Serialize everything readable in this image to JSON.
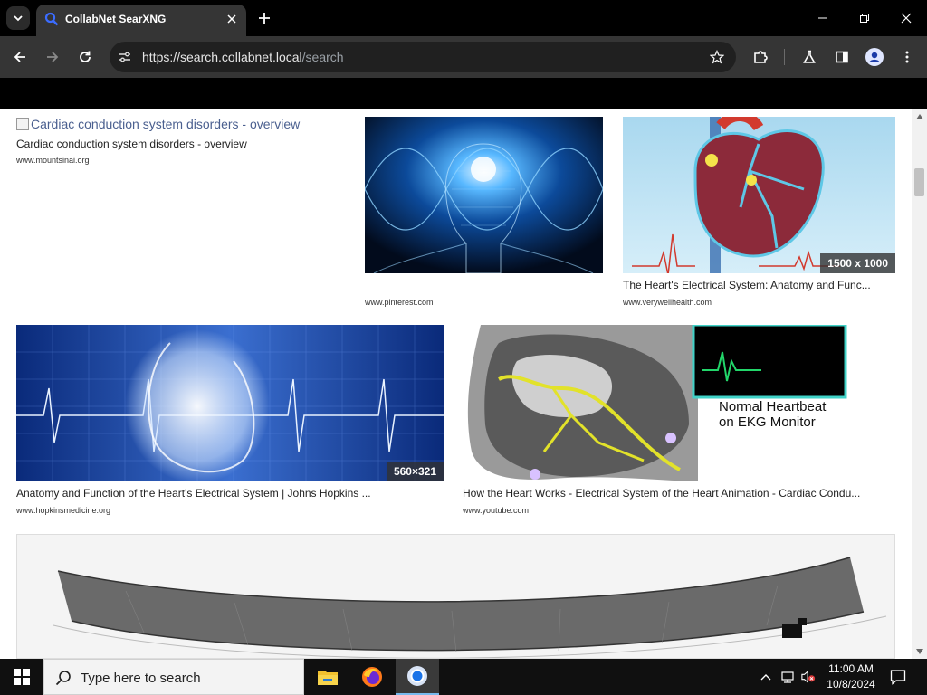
{
  "browser": {
    "tab": {
      "title": "CollabNet SearXNG",
      "close_icon": "close-icon",
      "favicon": "search-icon"
    },
    "url": {
      "host": "https://search.collabnet.local",
      "path": "/search"
    },
    "colors": {
      "titlebar": "#000000",
      "toolbar": "#353535",
      "omnibox": "#202020"
    }
  },
  "results": [
    {
      "broken_alt": "Cardiac conduction system disorders - overview",
      "title": "Cardiac conduction system disorders - overview",
      "site": "www.mountsinai.org"
    },
    {
      "title": "",
      "site": "www.pinterest.com"
    },
    {
      "title": "The Heart's Electrical System: Anatomy and Func...",
      "site": "www.verywellhealth.com",
      "resolution": "1500 x 1000"
    },
    {
      "title": "Anatomy and Function of the Heart's Electrical System | Johns Hopkins ...",
      "site": "www.hopkinsmedicine.org",
      "resolution": "560×321"
    },
    {
      "title": "How the Heart Works - Electrical System of the Heart Animation - Cardiac Condu...",
      "site": "www.youtube.com",
      "image_caption_1": "Normal Heartbeat",
      "image_caption_2": "on EKG Monitor"
    },
    {
      "title": "",
      "site": ""
    }
  ],
  "taskbar": {
    "search_placeholder": "Type here to search",
    "time": "11:00 AM",
    "date": "10/8/2024",
    "apps": [
      "file-explorer",
      "firefox",
      "chrome"
    ]
  }
}
